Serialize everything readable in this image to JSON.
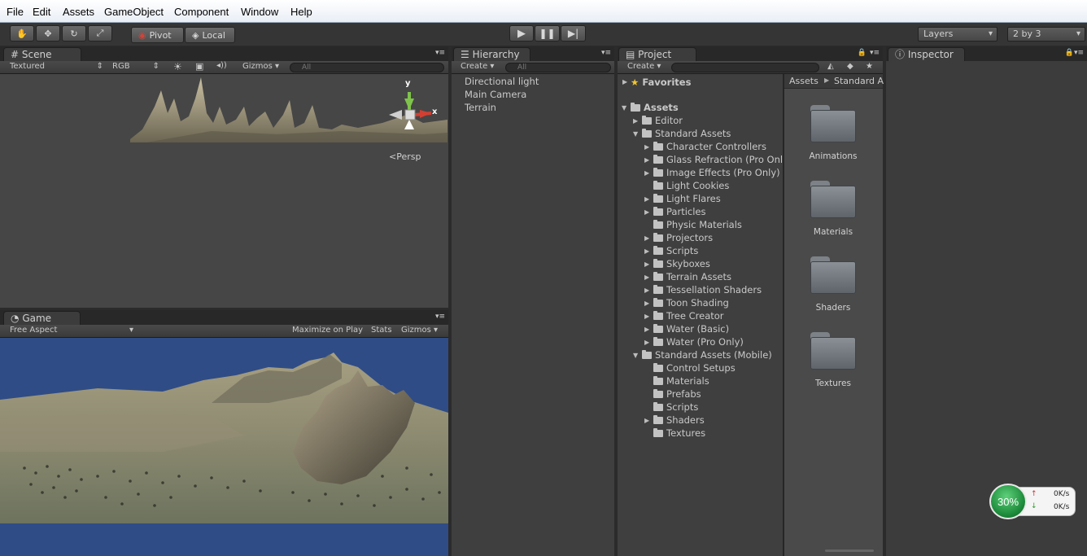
{
  "menu": [
    "File",
    "Edit",
    "Assets",
    "GameObject",
    "Component",
    "Window",
    "Help"
  ],
  "toolbar": {
    "pivot": "Pivot",
    "local": "Local",
    "layers": "Layers",
    "layout": "2 by 3"
  },
  "scene": {
    "tab": "Scene",
    "render_mode": "Textured",
    "color_mode": "RGB",
    "gizmos": "Gizmos",
    "search_placeholder": "All",
    "persp": "Persp",
    "axis_y": "y",
    "axis_x": "x"
  },
  "game": {
    "tab": "Game",
    "aspect": "Free Aspect",
    "maximize": "Maximize on Play",
    "stats": "Stats",
    "gizmos": "Gizmos"
  },
  "hierarchy": {
    "tab": "Hierarchy",
    "create": "Create",
    "search_placeholder": "All",
    "items": [
      "Directional light",
      "Main Camera",
      "Terrain"
    ]
  },
  "project": {
    "tab": "Project",
    "create": "Create",
    "favorites": "Favorites",
    "assets": "Assets",
    "tree": [
      {
        "label": "Editor",
        "level": 1,
        "arrow": true
      },
      {
        "label": "Standard Assets",
        "level": 1,
        "arrow": true,
        "open": true
      },
      {
        "label": "Character Controllers",
        "level": 2,
        "arrow": true
      },
      {
        "label": "Glass Refraction (Pro Onl",
        "level": 2,
        "arrow": true
      },
      {
        "label": "Image Effects (Pro Only)",
        "level": 2,
        "arrow": true
      },
      {
        "label": "Light Cookies",
        "level": 2,
        "arrow": false
      },
      {
        "label": "Light Flares",
        "level": 2,
        "arrow": true
      },
      {
        "label": "Particles",
        "level": 2,
        "arrow": true
      },
      {
        "label": "Physic Materials",
        "level": 2,
        "arrow": false
      },
      {
        "label": "Projectors",
        "level": 2,
        "arrow": true
      },
      {
        "label": "Scripts",
        "level": 2,
        "arrow": true
      },
      {
        "label": "Skyboxes",
        "level": 2,
        "arrow": true
      },
      {
        "label": "Terrain Assets",
        "level": 2,
        "arrow": true
      },
      {
        "label": "Tessellation Shaders",
        "level": 2,
        "arrow": true
      },
      {
        "label": "Toon Shading",
        "level": 2,
        "arrow": true
      },
      {
        "label": "Tree Creator",
        "level": 2,
        "arrow": true
      },
      {
        "label": "Water (Basic)",
        "level": 2,
        "arrow": true
      },
      {
        "label": "Water (Pro Only)",
        "level": 2,
        "arrow": true
      },
      {
        "label": "Standard Assets (Mobile)",
        "level": 1,
        "arrow": true,
        "open": true
      },
      {
        "label": "Control Setups",
        "level": 2,
        "arrow": false
      },
      {
        "label": "Materials",
        "level": 2,
        "arrow": false
      },
      {
        "label": "Prefabs",
        "level": 2,
        "arrow": false
      },
      {
        "label": "Scripts",
        "level": 2,
        "arrow": false
      },
      {
        "label": "Shaders",
        "level": 2,
        "arrow": true
      },
      {
        "label": "Textures",
        "level": 2,
        "arrow": false
      }
    ],
    "breadcrumb_root": "Assets",
    "breadcrumb_child": "Standard A",
    "grid": [
      "Animations",
      "Materials",
      "Shaders",
      "Textures"
    ]
  },
  "inspector": {
    "tab": "Inspector"
  },
  "net_widget": {
    "percent": "30%",
    "up": "0K/s",
    "down": "0K/s"
  },
  "colors": {
    "play_green": "#2eaa4a",
    "sky_blue": "#2f4c86",
    "terrain": "#8d8a73"
  }
}
